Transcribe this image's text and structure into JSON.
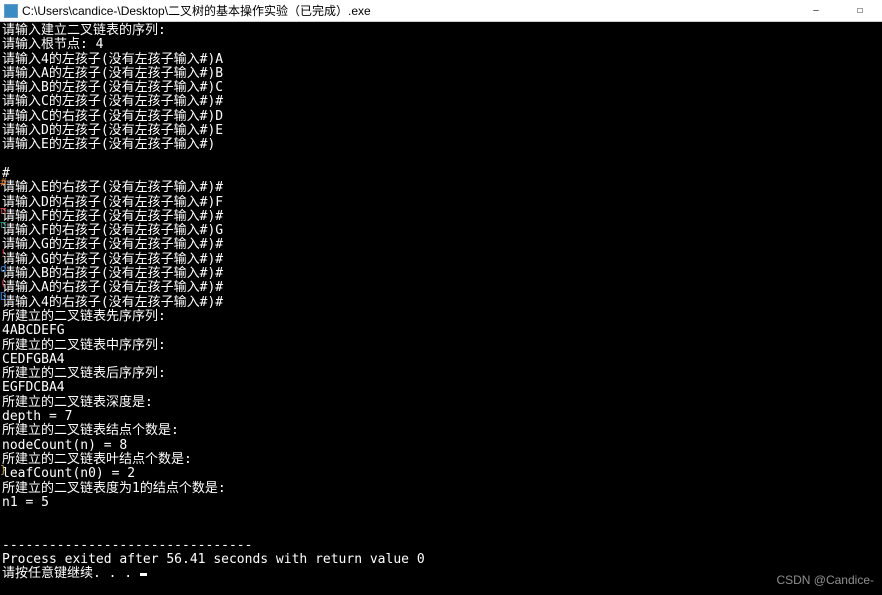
{
  "window": {
    "title": "C:\\Users\\candice-\\Desktop\\二叉树的基本操作实验（已完成）.exe",
    "minimize": "—",
    "maximize": "☐"
  },
  "gutter": [
    {
      "t": 154,
      "c": "gm-orange",
      "ch": "#"
    },
    {
      "t": 182,
      "c": "gm-red",
      "ch": "π"
    },
    {
      "t": 196,
      "c": "gm-teal",
      "ch": "π"
    },
    {
      "t": 225,
      "c": "gm-red",
      "ch": "!"
    },
    {
      "t": 240,
      "c": "gm-blue",
      "ch": "d"
    },
    {
      "t": 254,
      "c": "gm-red",
      "ch": "("
    },
    {
      "t": 268,
      "c": "gm-blue",
      "ch": "D"
    },
    {
      "t": 441,
      "c": "gm-yellow",
      "ch": "}"
    }
  ],
  "console_lines": [
    "请输入建立二叉链表的序列:",
    "请输入根节点: 4",
    "请输入4的左孩子(没有左孩子输入#)A",
    "请输入A的左孩子(没有左孩子输入#)B",
    "请输入B的左孩子(没有左孩子输入#)C",
    "请输入C的左孩子(没有左孩子输入#)#",
    "请输入C的右孩子(没有左孩子输入#)D",
    "请输入D的左孩子(没有左孩子输入#)E",
    "请输入E的左孩子(没有左孩子输入#)",
    "",
    "#",
    "请输入E的右孩子(没有左孩子输入#)#",
    "请输入D的右孩子(没有左孩子输入#)F",
    "请输入F的左孩子(没有左孩子输入#)#",
    "请输入F的右孩子(没有左孩子输入#)G",
    "请输入G的左孩子(没有左孩子输入#)#",
    "请输入G的右孩子(没有左孩子输入#)#",
    "请输入B的右孩子(没有左孩子输入#)#",
    "请输入A的右孩子(没有左孩子输入#)#",
    "请输入4的右孩子(没有左孩子输入#)#",
    "所建立的二叉链表先序序列:",
    "4ABCDEFG",
    "所建立的二叉链表中序序列:",
    "CEDFGBA4",
    "所建立的二叉链表后序序列:",
    "EGFDCBA4",
    "所建立的二叉链表深度是:",
    "depth = 7",
    "所建立的二叉链表结点个数是:",
    "nodeCount(n) = 8",
    "所建立的二叉链表叶结点个数是:",
    "leafCount(n0) = 2",
    "所建立的二叉链表度为1的结点个数是:",
    "n1 = 5",
    "",
    "",
    "--------------------------------",
    "Process exited after 56.41 seconds with return value 0"
  ],
  "final_prompt": "请按任意键继续. . . ",
  "watermark": "CSDN @Candice-"
}
